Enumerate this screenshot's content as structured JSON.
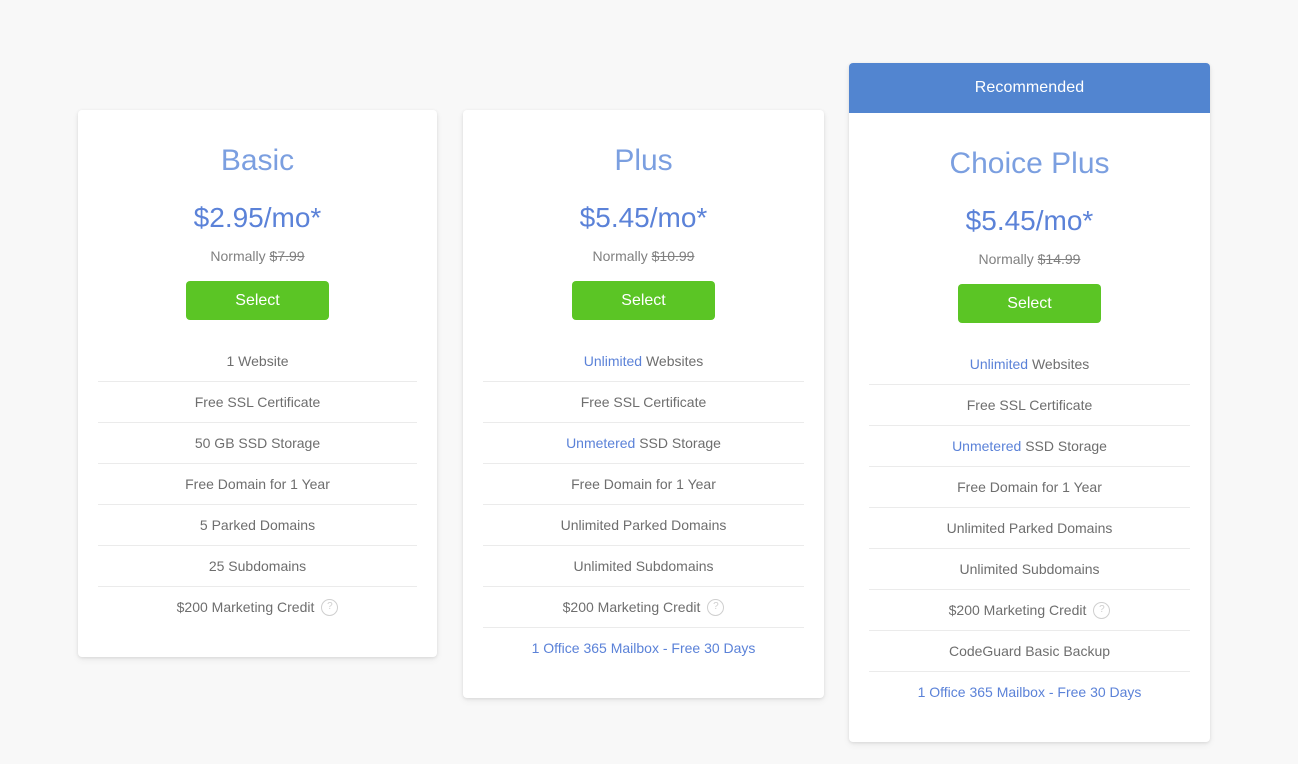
{
  "page": {
    "background": "#f8f8f8",
    "accent_blue": "#5b82d8",
    "title_blue": "#7b9fe0",
    "ribbon_blue": "#5285d0",
    "button_green": "#5bc525",
    "divider": "#ebebeb",
    "feature_text": "#6e6e6e"
  },
  "plans": [
    {
      "id": "basic",
      "name": "Basic",
      "price": "$2.95/mo*",
      "normally_label": "Normally",
      "normally_price": "$7.99",
      "select_label": "Select",
      "ribbon": null,
      "features": [
        {
          "pre": "",
          "highlight": "",
          "text": "1 Website",
          "help": false,
          "link": false
        },
        {
          "pre": "",
          "highlight": "",
          "text": "Free SSL Certificate",
          "help": false,
          "link": false
        },
        {
          "pre": "",
          "highlight": "",
          "text": "50 GB SSD Storage",
          "help": false,
          "link": false
        },
        {
          "pre": "",
          "highlight": "",
          "text": "Free Domain for 1 Year",
          "help": false,
          "link": false
        },
        {
          "pre": "",
          "highlight": "",
          "text": "5 Parked Domains",
          "help": false,
          "link": false
        },
        {
          "pre": "",
          "highlight": "",
          "text": "25 Subdomains",
          "help": false,
          "link": false
        },
        {
          "pre": "",
          "highlight": "",
          "text": "$200 Marketing Credit",
          "help": true,
          "help_icon": "help-question-icon",
          "link": false
        }
      ]
    },
    {
      "id": "plus",
      "name": "Plus",
      "price": "$5.45/mo*",
      "normally_label": "Normally",
      "normally_price": "$10.99",
      "select_label": "Select",
      "ribbon": null,
      "features": [
        {
          "pre": "",
          "highlight": "Unlimited",
          "text": " Websites",
          "help": false,
          "link": false
        },
        {
          "pre": "",
          "highlight": "",
          "text": "Free SSL Certificate",
          "help": false,
          "link": false
        },
        {
          "pre": "",
          "highlight": "Unmetered",
          "text": " SSD Storage",
          "help": false,
          "link": false
        },
        {
          "pre": "",
          "highlight": "",
          "text": "Free Domain for 1 Year",
          "help": false,
          "link": false
        },
        {
          "pre": "",
          "highlight": "",
          "text": "Unlimited Parked Domains",
          "help": false,
          "link": false
        },
        {
          "pre": "",
          "highlight": "",
          "text": "Unlimited Subdomains",
          "help": false,
          "link": false
        },
        {
          "pre": "",
          "highlight": "",
          "text": "$200 Marketing Credit",
          "help": true,
          "help_icon": "help-question-icon",
          "link": false
        },
        {
          "pre": "",
          "highlight": "",
          "text": "1 Office 365 Mailbox - Free 30 Days",
          "help": false,
          "link": true
        }
      ]
    },
    {
      "id": "choiceplus",
      "name": "Choice Plus",
      "price": "$5.45/mo*",
      "normally_label": "Normally",
      "normally_price": "$14.99",
      "select_label": "Select",
      "ribbon": "Recommended",
      "features": [
        {
          "pre": "",
          "highlight": "Unlimited",
          "text": " Websites",
          "help": false,
          "link": false
        },
        {
          "pre": "",
          "highlight": "",
          "text": "Free SSL Certificate",
          "help": false,
          "link": false
        },
        {
          "pre": "",
          "highlight": "Unmetered",
          "text": " SSD Storage",
          "help": false,
          "link": false
        },
        {
          "pre": "",
          "highlight": "",
          "text": "Free Domain for 1 Year",
          "help": false,
          "link": false
        },
        {
          "pre": "",
          "highlight": "",
          "text": "Unlimited Parked Domains",
          "help": false,
          "link": false
        },
        {
          "pre": "",
          "highlight": "",
          "text": "Unlimited Subdomains",
          "help": false,
          "link": false
        },
        {
          "pre": "",
          "highlight": "",
          "text": "$200 Marketing Credit",
          "help": true,
          "help_icon": "help-question-icon",
          "link": false
        },
        {
          "pre": "",
          "highlight": "",
          "text": "CodeGuard Basic Backup",
          "help": false,
          "link": false
        },
        {
          "pre": "",
          "highlight": "",
          "text": "1 Office 365 Mailbox - Free 30 Days",
          "help": false,
          "link": true
        }
      ]
    }
  ],
  "help_glyph": "?"
}
